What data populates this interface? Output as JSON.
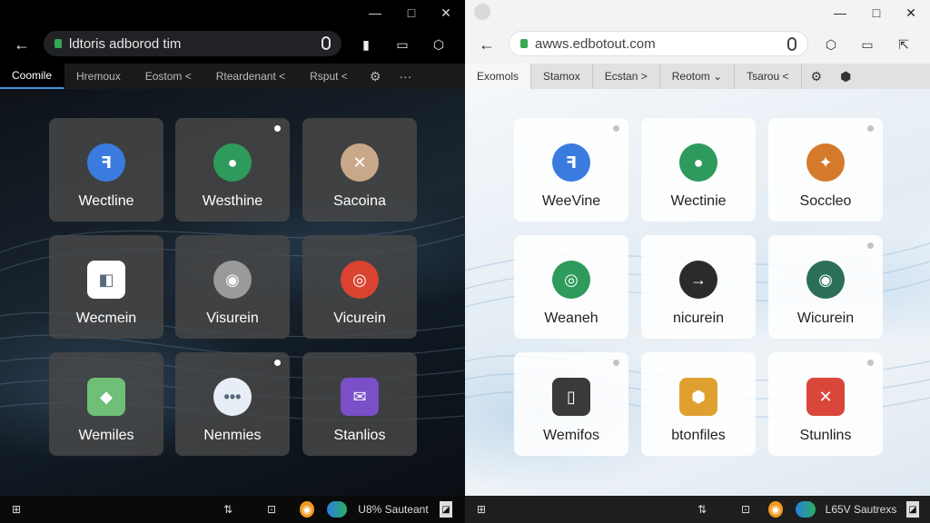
{
  "left": {
    "window": {
      "min_glyph": "—",
      "max_glyph": "□",
      "close_glyph": "✕"
    },
    "address": {
      "url": "ldtoris adborod tim"
    },
    "tabs": [
      {
        "label": "Coomile",
        "active": true
      },
      {
        "label": "Hremoux",
        "active": false
      },
      {
        "label": "Eostom <",
        "active": false
      },
      {
        "label": "Rteardenant <",
        "active": false
      },
      {
        "label": "Rsput <",
        "active": false
      }
    ],
    "tab_more": "···",
    "tiles": [
      {
        "label": "Wectline",
        "icon": "document-icon",
        "color": "#3b7be0",
        "glyph": "ꟻ"
      },
      {
        "label": "Westhine",
        "icon": "chat-icon",
        "color": "#2e9a5c",
        "glyph": "●"
      },
      {
        "label": "Sacoina",
        "icon": "tools-icon",
        "color": "#c9a88a",
        "glyph": "✕"
      },
      {
        "label": "Wecmein",
        "icon": "app-icon",
        "color": "#ffffff",
        "glyph": "◧"
      },
      {
        "label": "Visurein",
        "icon": "eye-icon",
        "color": "#9a9a9a",
        "glyph": "◉"
      },
      {
        "label": "Vicurein",
        "icon": "chrome-icon",
        "color": "#d9432f",
        "glyph": "◎"
      },
      {
        "label": "Wemiles",
        "icon": "folder-icon",
        "color": "#6fbf77",
        "glyph": "◆"
      },
      {
        "label": "Nenmies",
        "icon": "more-icon",
        "color": "#e8eef5",
        "glyph": "•••"
      },
      {
        "label": "Stanlios",
        "icon": "mail-icon",
        "color": "#7a4fc7",
        "glyph": "✉"
      }
    ],
    "taskbar": {
      "status": "U8% Sauteant"
    }
  },
  "right": {
    "window": {
      "min_glyph": "—",
      "max_glyph": "□",
      "close_glyph": "✕"
    },
    "address": {
      "url": "awws.edbotout.com"
    },
    "tabs": [
      {
        "label": "Exomols",
        "active": true
      },
      {
        "label": "Stamox",
        "active": false
      },
      {
        "label": "Ecstan >",
        "active": false
      },
      {
        "label": "Reotom ⌄",
        "active": false
      },
      {
        "label": "Tsarou <",
        "active": false
      }
    ],
    "tiles": [
      {
        "label": "WeeVine",
        "icon": "document-icon",
        "color": "#3b7be0",
        "glyph": "ꟻ"
      },
      {
        "label": "Wectinie",
        "icon": "chat-icon",
        "color": "#2e9a5c",
        "glyph": "●"
      },
      {
        "label": "Socclео",
        "icon": "network-icon",
        "color": "#d47a2a",
        "glyph": "✦"
      },
      {
        "label": "Weaneh",
        "icon": "chrome-icon",
        "color": "#2e9a5c",
        "glyph": "◎"
      },
      {
        "label": "nicurein",
        "icon": "arrow-icon",
        "color": "#2b2b2b",
        "glyph": "→"
      },
      {
        "label": "Wicurein",
        "icon": "camera-icon",
        "color": "#2b6f5a",
        "glyph": "◉"
      },
      {
        "label": "Wemifos",
        "icon": "paper-icon",
        "color": "#3a3a3a",
        "glyph": "▯"
      },
      {
        "label": "btonfiles",
        "icon": "shield-icon",
        "color": "#e0a030",
        "glyph": "⬢"
      },
      {
        "label": "Stunlins",
        "icon": "close-box-icon",
        "color": "#d9473a",
        "glyph": "✕"
      }
    ],
    "taskbar": {
      "status": "L65V Sautrexs"
    }
  }
}
